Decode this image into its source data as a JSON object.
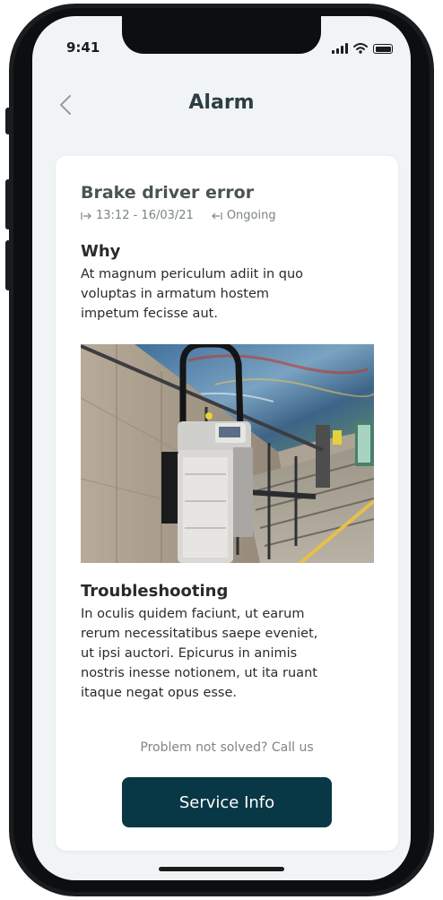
{
  "status_bar": {
    "time": "9:41"
  },
  "header": {
    "title": "Alarm",
    "back_icon": "chevron-left-icon"
  },
  "alarm": {
    "title": "Brake driver error",
    "start_icon": "start-arrow-icon",
    "start": "13:12 - 16/03/21",
    "end_icon": "end-arrow-icon",
    "end": "Ongoing"
  },
  "why": {
    "title": "Why",
    "lines": [
      "At magnum periculum adiit in quo",
      "voluptas in armatum hostem",
      "impetum fecisse aut."
    ]
  },
  "troubleshooting": {
    "title": "Troubleshooting",
    "lines": [
      "In oculis quidem faciunt, ut earum",
      "rerum necessitatibus saepe eveniet,",
      "ut ipsi auctori. Epicurus in animis",
      "nostris inesse notionem, ut ita ruant",
      "itaque negat opus esse."
    ]
  },
  "help": {
    "prompt": "Problem not solved? Call us",
    "button_label": "Service Info"
  },
  "colors": {
    "primary": "#083846",
    "screen_bg": "#f1f4f5",
    "card_bg": "#ffffff"
  }
}
